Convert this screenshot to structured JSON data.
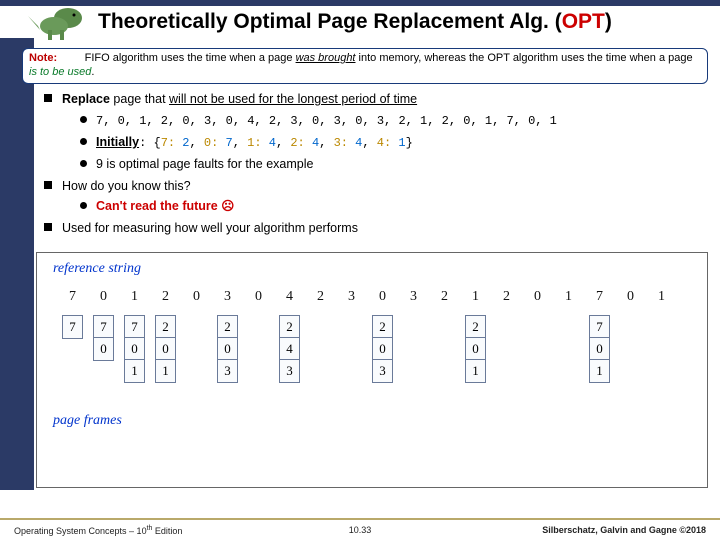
{
  "title": {
    "main": "Theoretically Optimal Page Replacement Alg. (",
    "highlight": "OPT",
    "tail": ")"
  },
  "note": {
    "label": "Note:",
    "t1": "FIFO algorithm uses the time when a page ",
    "em1": "was brought",
    "t2": " into memory, whereas the OPT algorithm uses the time when a page ",
    "em2": "is to be used",
    "t3": "."
  },
  "b1": {
    "pre": "Replace",
    "post": " page that ",
    "u": "will not be used for the longest period of time"
  },
  "ref_inline": "7, 0, 1, 2, 0, 3, 0, 4, 2, 3, 0, 3, 0, 3, 2, 1, 2, 0, 1, 7, 0, 1",
  "init": {
    "label": "Initially",
    "colon": ": ",
    "map": [
      {
        "k": "7",
        "v": "2"
      },
      {
        "k": "0",
        "v": "7"
      },
      {
        "k": "1",
        "v": "4"
      },
      {
        "k": "2",
        "v": "4"
      },
      {
        "k": "3",
        "v": "4"
      },
      {
        "k": "4",
        "v": "1"
      }
    ]
  },
  "b_opt": "9 is optimal page faults for the example",
  "b2": "How do you know this?",
  "b2s": "Can't read the future ☹",
  "b3": "Used for measuring how well your algorithm performs",
  "diagram": {
    "rs_label": "reference string",
    "pf_label": "page frames",
    "ref": [
      "7",
      "0",
      "1",
      "2",
      "0",
      "3",
      "0",
      "4",
      "2",
      "3",
      "0",
      "3",
      "2",
      "1",
      "2",
      "0",
      "1",
      "7",
      "0",
      "1"
    ],
    "frames": [
      [
        "7"
      ],
      [
        "7",
        "0"
      ],
      [
        "7",
        "0",
        "1"
      ],
      [
        "2",
        "0",
        "1"
      ],
      null,
      [
        "2",
        "0",
        "3"
      ],
      null,
      [
        "2",
        "4",
        "3"
      ],
      null,
      null,
      [
        "2",
        "0",
        "3"
      ],
      null,
      null,
      [
        "2",
        "0",
        "1"
      ],
      null,
      null,
      null,
      [
        "7",
        "0",
        "1"
      ],
      null,
      null
    ]
  },
  "footer": {
    "left_a": "Operating System Concepts – 10",
    "left_b": " Edition",
    "center": "10.33",
    "right_a": "Silberschatz, Galvin and Gagne ",
    "right_b": "2018",
    "copy": "©",
    "th": "th"
  }
}
